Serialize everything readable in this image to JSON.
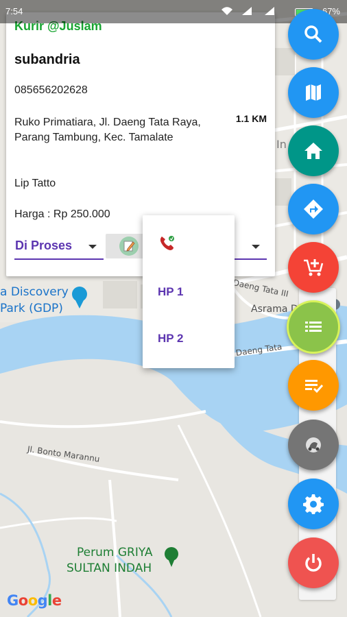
{
  "status_bar": {
    "time": "7:54",
    "battery": "67%"
  },
  "map": {
    "poi": [
      {
        "name": "a Discovery",
        "color": "#1a73c9"
      },
      {
        "name": "Park (GDP)",
        "color": "#1a73c9"
      },
      {
        "name": "Perum GRIYA",
        "color": "#1e7e34"
      },
      {
        "name": "SULTAN INDAH",
        "color": "#1e7e34"
      }
    ],
    "roads": [
      "Daeng Tata III",
      "Daeng Tata",
      "Jl. Bonto Marannu",
      "Asrama Day"
    ],
    "edge_fragments": [
      "In"
    ],
    "google": "Google"
  },
  "order_card": {
    "courier": "Kurir @Juslam",
    "customer_name": "subandria",
    "phone": "085656202628",
    "address": "Ruko Primatiara, Jl. Daeng Tata Raya, Parang Tambung, Kec. Tamalate",
    "distance": "1.1 KM",
    "item": "Lip Tatto",
    "price": "Harga : Rp 250.000",
    "status_select": {
      "selected": "Di Proses"
    }
  },
  "call_menu": {
    "icon": "phone-call-icon",
    "items": [
      {
        "label": "HP 1"
      },
      {
        "label": "HP 2"
      }
    ]
  },
  "fab_buttons": [
    {
      "name": "search",
      "icon": "search-icon",
      "color": "#2196f3"
    },
    {
      "name": "map",
      "icon": "map-icon",
      "color": "#2196f3"
    },
    {
      "name": "home",
      "icon": "home-icon",
      "color": "#009688"
    },
    {
      "name": "directions",
      "icon": "directions-icon",
      "color": "#2196f3"
    },
    {
      "name": "add-to-cart",
      "icon": "add-cart-icon",
      "color": "#f44336"
    },
    {
      "name": "order-list",
      "icon": "list-icon",
      "color": "#8bc34a"
    },
    {
      "name": "completed-list",
      "icon": "checklist-icon",
      "color": "#ff9800"
    },
    {
      "name": "delivery",
      "icon": "courier-icon",
      "color": "#757575"
    },
    {
      "name": "settings",
      "icon": "gear-icon",
      "color": "#2196f3"
    },
    {
      "name": "logout",
      "icon": "power-icon",
      "color": "#f44336"
    }
  ]
}
